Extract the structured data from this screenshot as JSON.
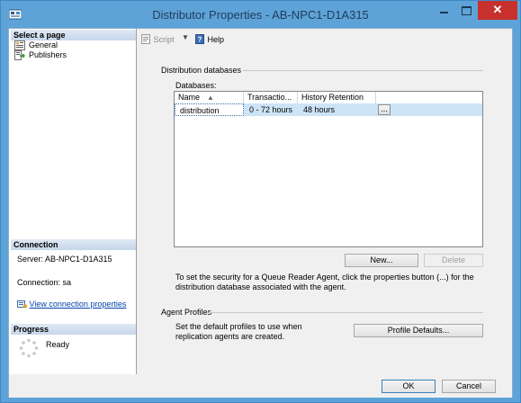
{
  "window": {
    "title": "Distributor Properties - AB-NPC1-D1A315",
    "close_label": "✕"
  },
  "left_pane": {
    "select_page_header": "Select a page",
    "pages": [
      {
        "label": "General",
        "icon": "page-properties-icon"
      },
      {
        "label": "Publishers",
        "icon": "publishers-icon"
      }
    ],
    "connection_header": "Connection",
    "server_text": "Server: AB-NPC1-D1A315",
    "connection_text": "Connection: sa",
    "view_connection_link": "View connection properties",
    "progress_header": "Progress",
    "progress_status": "Ready"
  },
  "toolbar": {
    "script_label": "Script",
    "help_label": "Help"
  },
  "distribution": {
    "group_title": "Distribution databases",
    "databases_label": "Databases:",
    "columns": [
      "Name",
      "Transactio...",
      "History Retention"
    ],
    "rows": [
      {
        "name": "distribution",
        "transaction": "0 - 72 hours",
        "history": "48 hours"
      }
    ],
    "ellipsis_label": "...",
    "new_button": "New...",
    "delete_button": "Delete",
    "security_note_line1": "To set the security for a Queue Reader Agent, click the properties button (...) for the",
    "security_note_line2": "distribution database associated with the agent."
  },
  "agent_profiles": {
    "group_title": "Agent Profiles",
    "description_line1": "Set the default profiles to use when",
    "description_line2": "replication agents are created.",
    "profile_defaults_button": "Profile Defaults..."
  },
  "footer": {
    "ok_button": "OK",
    "cancel_button": "Cancel"
  },
  "colors": {
    "title_bar": "#5ea3d8",
    "close_button": "#c7302c",
    "selected_row": "#cde4f7",
    "link": "#0645ad"
  }
}
